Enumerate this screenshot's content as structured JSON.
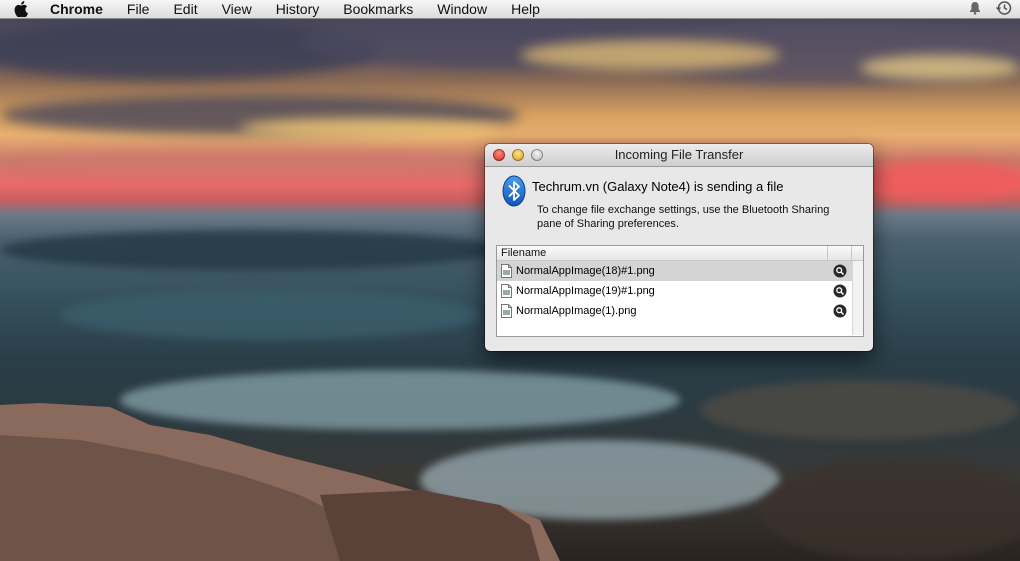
{
  "menubar": {
    "app_name": "Chrome",
    "items": [
      "File",
      "Edit",
      "View",
      "History",
      "Bookmarks",
      "Window"
    ],
    "help": "Help",
    "status_icons": [
      "bell-icon",
      "time-machine-icon"
    ]
  },
  "dialog": {
    "title": "Incoming File Transfer",
    "headline": "Techrum.vn (Galaxy Note4) is sending a file",
    "description": "To change file exchange settings, use the Bluetooth Sharing pane of Sharing preferences.",
    "column_header": "Filename",
    "files": [
      {
        "name": "NormalAppImage(18)#1.png",
        "selected": true
      },
      {
        "name": "NormalAppImage(19)#1.png",
        "selected": false
      },
      {
        "name": "NormalAppImage(1).png",
        "selected": false
      }
    ]
  },
  "colors": {
    "bluetooth": "#1a6fd8",
    "selection": "#d4d4d4",
    "close": "#d4231a",
    "minimize": "#d99a10"
  }
}
